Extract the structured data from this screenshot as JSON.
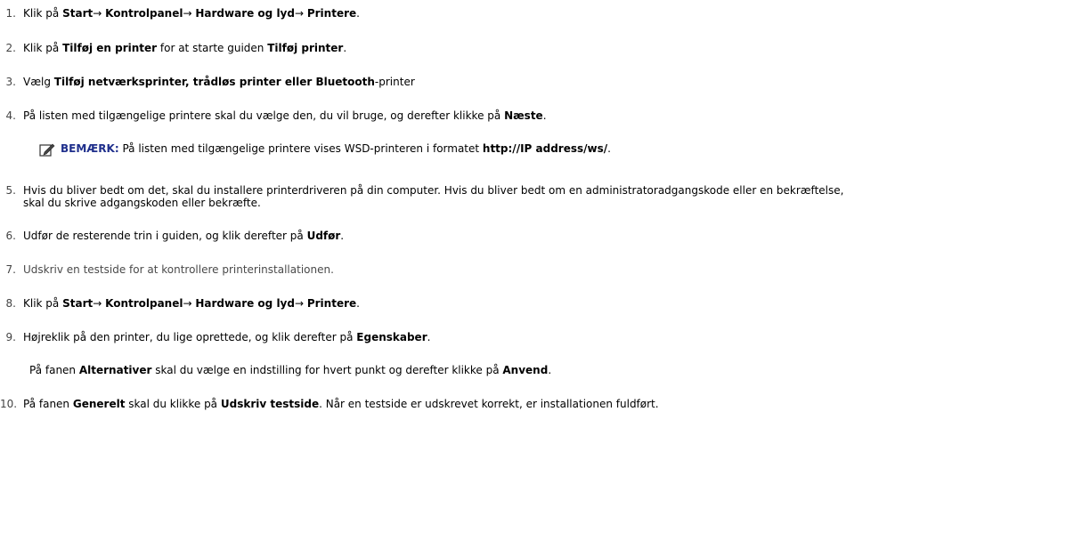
{
  "steps": [
    {
      "number": "1.",
      "parts": [
        {
          "text": "Klik på ",
          "bold": false
        },
        {
          "text": "Start",
          "bold": true
        },
        {
          "text": "→ ",
          "bold": false
        },
        {
          "text": "Kontrolpanel",
          "bold": true
        },
        {
          "text": "→ ",
          "bold": false
        },
        {
          "text": "Hardware og lyd",
          "bold": true
        },
        {
          "text": "→ ",
          "bold": false
        },
        {
          "text": "Printere",
          "bold": true
        },
        {
          "text": ".",
          "bold": false
        }
      ]
    },
    {
      "number": "2.",
      "parts": [
        {
          "text": "Klik på ",
          "bold": false
        },
        {
          "text": "Tilføj en printer",
          "bold": true
        },
        {
          "text": " for at starte guiden ",
          "bold": false
        },
        {
          "text": "Tilføj printer",
          "bold": true
        },
        {
          "text": ".",
          "bold": false
        }
      ]
    },
    {
      "number": "3.",
      "parts": [
        {
          "text": "Vælg ",
          "bold": false
        },
        {
          "text": "Tilføj netværksprinter, trådløs printer eller Bluetooth",
          "bold": true
        },
        {
          "text": "-printer",
          "bold": false
        }
      ]
    },
    {
      "number": "4.",
      "parts": [
        {
          "text": "På listen med tilgængelige printere skal du vælge den, du vil bruge, og derefter klikke på ",
          "bold": false
        },
        {
          "text": "Næste",
          "bold": true
        },
        {
          "text": ".",
          "bold": false
        }
      ]
    },
    {
      "number": "5.",
      "parts": [
        {
          "text": "Hvis du bliver bedt om det, skal du installere printerdriveren på din computer. Hvis du bliver bedt om en administratoradgangskode eller en bekræftelse,",
          "bold": false
        }
      ],
      "continuation": "skal du skrive adgangskoden eller bekræfte."
    },
    {
      "number": "6.",
      "parts": [
        {
          "text": "Udfør de resterende trin i guiden, og klik derefter på ",
          "bold": false
        },
        {
          "text": "Udfør",
          "bold": true
        },
        {
          "text": ".",
          "bold": false
        }
      ]
    },
    {
      "number": "7.",
      "parts": [
        {
          "text": "Udskriv en testside for at kontrollere printerinstallationen.",
          "bold": false
        }
      ]
    },
    {
      "number": "8.",
      "parts": [
        {
          "text": "Klik på ",
          "bold": false
        },
        {
          "text": "Start",
          "bold": true
        },
        {
          "text": "→ ",
          "bold": false
        },
        {
          "text": "Kontrolpanel",
          "bold": true
        },
        {
          "text": "→ ",
          "bold": false
        },
        {
          "text": "Hardware og lyd",
          "bold": true
        },
        {
          "text": "→ ",
          "bold": false
        },
        {
          "text": "Printere",
          "bold": true
        },
        {
          "text": ".",
          "bold": false
        }
      ]
    },
    {
      "number": "9.",
      "parts": [
        {
          "text": "Højreklik på den printer, du lige oprettede, og klik derefter på ",
          "bold": false
        },
        {
          "text": "Egenskaber",
          "bold": true
        },
        {
          "text": ".",
          "bold": false
        }
      ]
    },
    {
      "number": "10.",
      "parts": [
        {
          "text": "På fanen ",
          "bold": false
        },
        {
          "text": "Generelt",
          "bold": true
        },
        {
          "text": " skal du klikke på ",
          "bold": false
        },
        {
          "text": "Udskriv testside",
          "bold": true
        },
        {
          "text": ". Når en testside er udskrevet korrekt, er installationen fuldført.",
          "bold": false
        }
      ]
    }
  ],
  "note": {
    "icon": "pencil-note-icon",
    "label": "BEMÆRK:",
    "parts": [
      {
        "text": " På listen med tilgængelige printere vises WSD-printeren i formatet ",
        "bold": false
      },
      {
        "text": "http://IP address/ws/",
        "bold": true
      },
      {
        "text": ".",
        "bold": false
      }
    ]
  },
  "step9_detail": {
    "parts": [
      {
        "text": "På fanen ",
        "bold": false
      },
      {
        "text": "Alternativer",
        "bold": true
      },
      {
        "text": " skal du vælge en indstilling for hvert punkt og derefter klikke på ",
        "bold": false
      },
      {
        "text": "Anvend",
        "bold": true
      },
      {
        "text": ".",
        "bold": false
      }
    ]
  },
  "colors": {
    "note_label": "#1f2f8c",
    "text": "#000000",
    "number": "#444444"
  }
}
